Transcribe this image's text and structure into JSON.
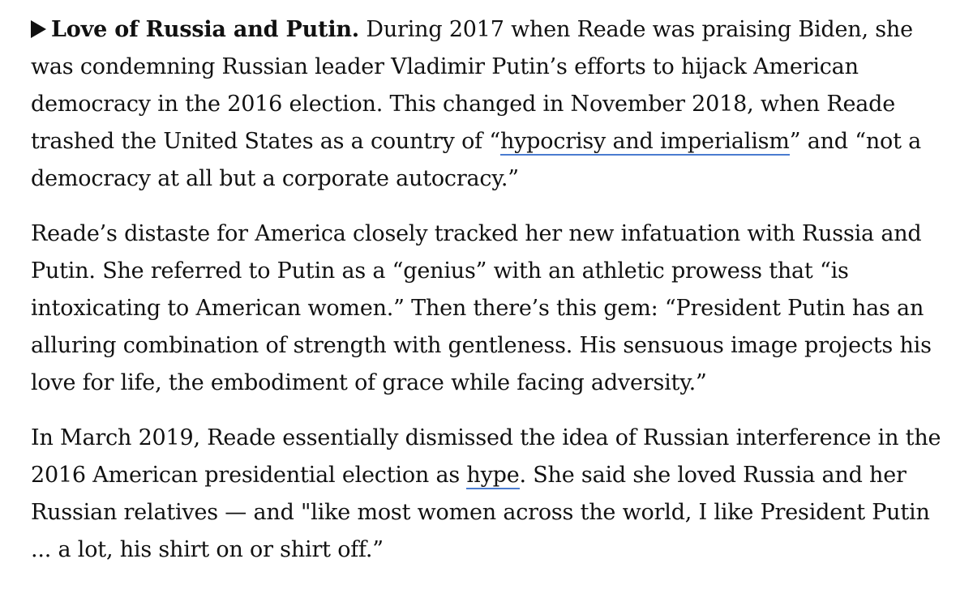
{
  "article": {
    "p1": {
      "lead": "Love of Russia and Putin.",
      "text1": " During 2017 when Reade was praising Biden, she was condemning Russian leader Vladimir Putin’s efforts to hijack American democracy in the 2016 election. This changed in November 2018, when Reade trashed the United States as a country of “",
      "link": "hypocrisy and imperialism",
      "text2": "” and “not a democracy at all but a corporate autocracy.”"
    },
    "p2": {
      "text": "Reade’s distaste for America closely tracked her new infatuation with Russia and Putin. She referred to Putin as a “genius” with an athletic prowess that “is intoxicating to American women.” Then there’s this gem: “President Putin has an alluring combination of strength with gentleness. His sensuous image projects his love for life, the embodiment of grace while facing adversity.”"
    },
    "p3": {
      "text1": "In March 2019, Reade essentially dismissed the idea of Russian interference in the 2016 American presidential election as ",
      "link": "hype",
      "text2": ". She said she loved Russia and her Russian relatives — and \"like most women across the world, I like President Putin ... a lot, his shirt on or shirt off.”"
    }
  },
  "colors": {
    "text": "#111111",
    "link_underline": "#4a7bd0",
    "background": "#ffffff"
  },
  "icons": {
    "bullet": "triangle-right-icon"
  }
}
